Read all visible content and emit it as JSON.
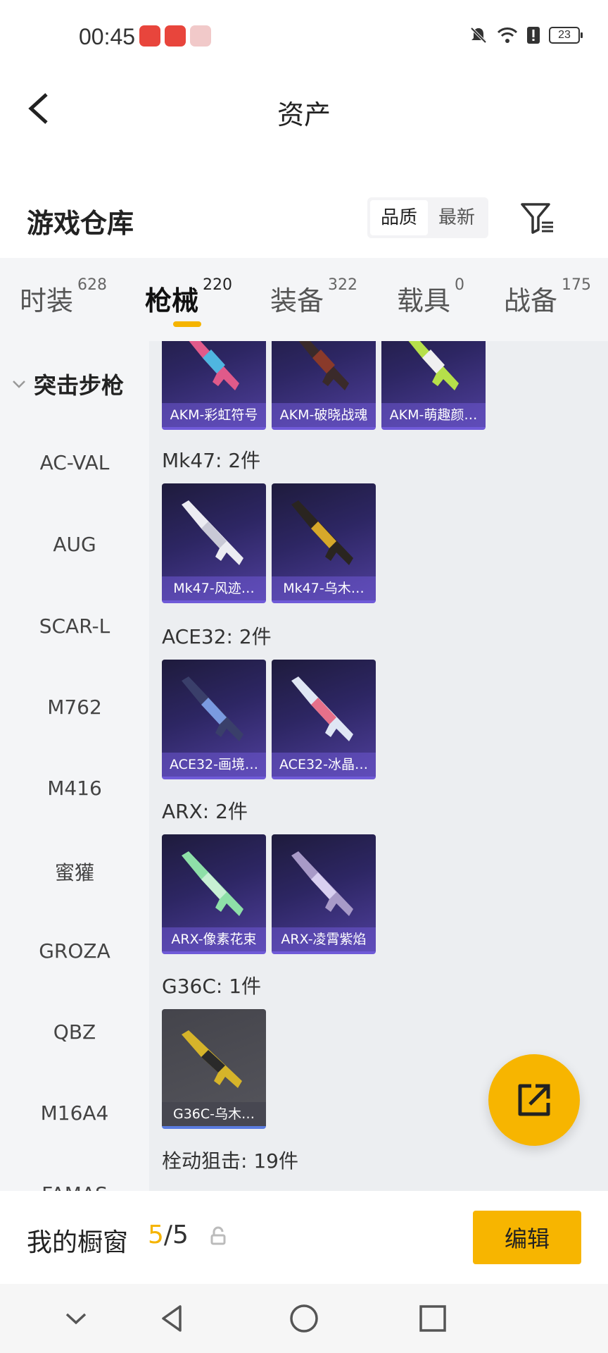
{
  "status_bar": {
    "time": "00:45",
    "battery": "23"
  },
  "header": {
    "title": "资产"
  },
  "warehouse": {
    "title": "游戏仓库",
    "sort_options": [
      {
        "label": "品质",
        "active": true
      },
      {
        "label": "最新",
        "active": false
      }
    ]
  },
  "tabs": [
    {
      "label": "时装",
      "count": "628"
    },
    {
      "label": "枪械",
      "count": "220"
    },
    {
      "label": "装备",
      "count": "322"
    },
    {
      "label": "载具",
      "count": "0"
    },
    {
      "label": "战备",
      "count": "175"
    }
  ],
  "sidebar": {
    "category": "突击步枪",
    "items": [
      "AC-VAL",
      "AUG",
      "SCAR-L",
      "M762",
      "M416",
      "蜜獾",
      "GROZA",
      "QBZ",
      "M16A4",
      "FAMAS"
    ]
  },
  "groups": [
    {
      "title": "",
      "items": [
        "AKM-彩虹符号",
        "AKM-破晓战魂",
        "AKM-萌趣颜…"
      ]
    },
    {
      "title": "Mk47: 2件",
      "items": [
        "Mk47-风迹…",
        "Mk47-乌木…"
      ]
    },
    {
      "title": "ACE32: 2件",
      "items": [
        "ACE32-画境…",
        "ACE32-冰晶…"
      ]
    },
    {
      "title": "ARX: 2件",
      "items": [
        "ARX-像素花束",
        "ARX-凌霄紫焰"
      ]
    },
    {
      "title": "G36C: 1件",
      "items": [
        "G36C-乌木…"
      ]
    },
    {
      "title": "栓动狙击: 19件",
      "items": []
    }
  ],
  "showcase": {
    "label": "我的橱窗",
    "current": "5",
    "separator": "/",
    "total": "5",
    "edit_label": "编辑"
  }
}
